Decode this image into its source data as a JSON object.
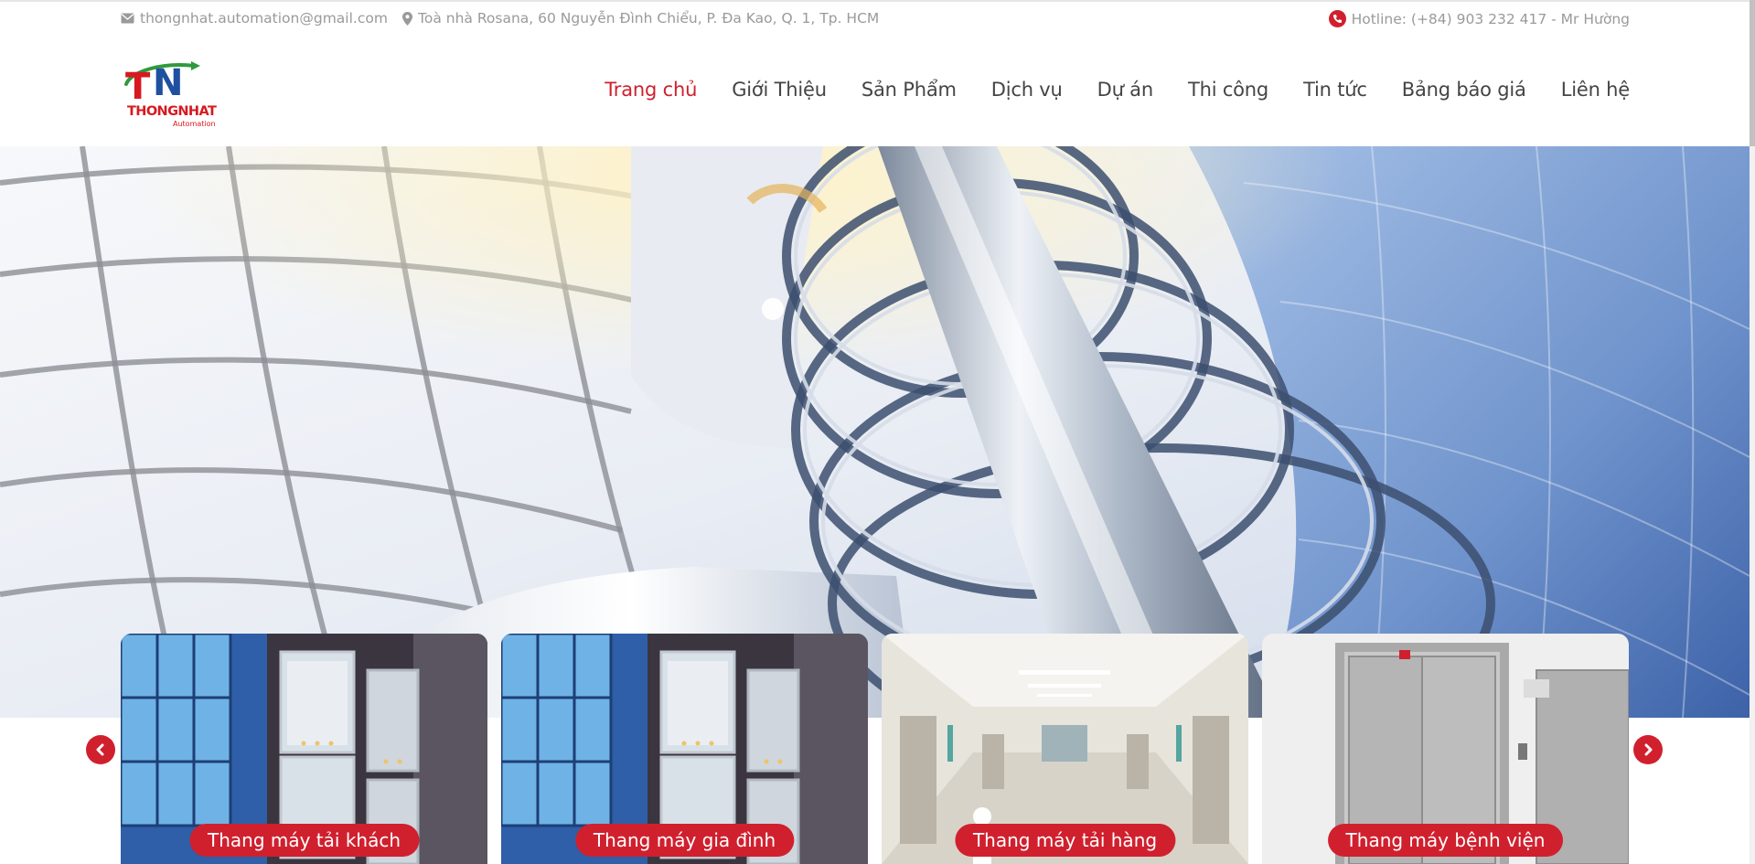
{
  "topbar": {
    "email": "thongnhat.automation@gmail.com",
    "address": "Toà nhà Rosana, 60 Nguyễn Đình Chiểu, P. Đa Kao, Q. 1, Tp. HCM",
    "hotline": "Hotline: (+84) 903 232 417 - Mr Hường",
    "icons": [
      "envelope-icon",
      "map-pin-icon",
      "phone-icon"
    ]
  },
  "logo": {
    "letters": "TN",
    "word": "THONGNHAT",
    "sub": "Automation"
  },
  "nav": {
    "items": [
      {
        "label": "Trang chủ",
        "active": true
      },
      {
        "label": "Giới Thiệu",
        "active": false
      },
      {
        "label": "Sản Phẩm",
        "active": false
      },
      {
        "label": "Dịch vụ",
        "active": false
      },
      {
        "label": "Dự án",
        "active": false
      },
      {
        "label": "Thi công",
        "active": false
      },
      {
        "label": "Tin tức",
        "active": false
      },
      {
        "label": "Bảng báo giá",
        "active": false
      },
      {
        "label": "Liên hệ",
        "active": false
      }
    ]
  },
  "slider": {
    "slide_count": 2,
    "active_index": 0
  },
  "products": {
    "cards": [
      {
        "label": "Thang máy tải khách"
      },
      {
        "label": "Thang máy gia đình"
      },
      {
        "label": "Thang máy tải hàng"
      },
      {
        "label": "Thang máy bệnh viện"
      }
    ],
    "prev_icon": "chevron-left-icon",
    "next_icon": "chevron-right-icon"
  },
  "colors": {
    "accent": "#d0202e",
    "nav_text": "#444444",
    "topbar_text": "#9a9a9a"
  }
}
